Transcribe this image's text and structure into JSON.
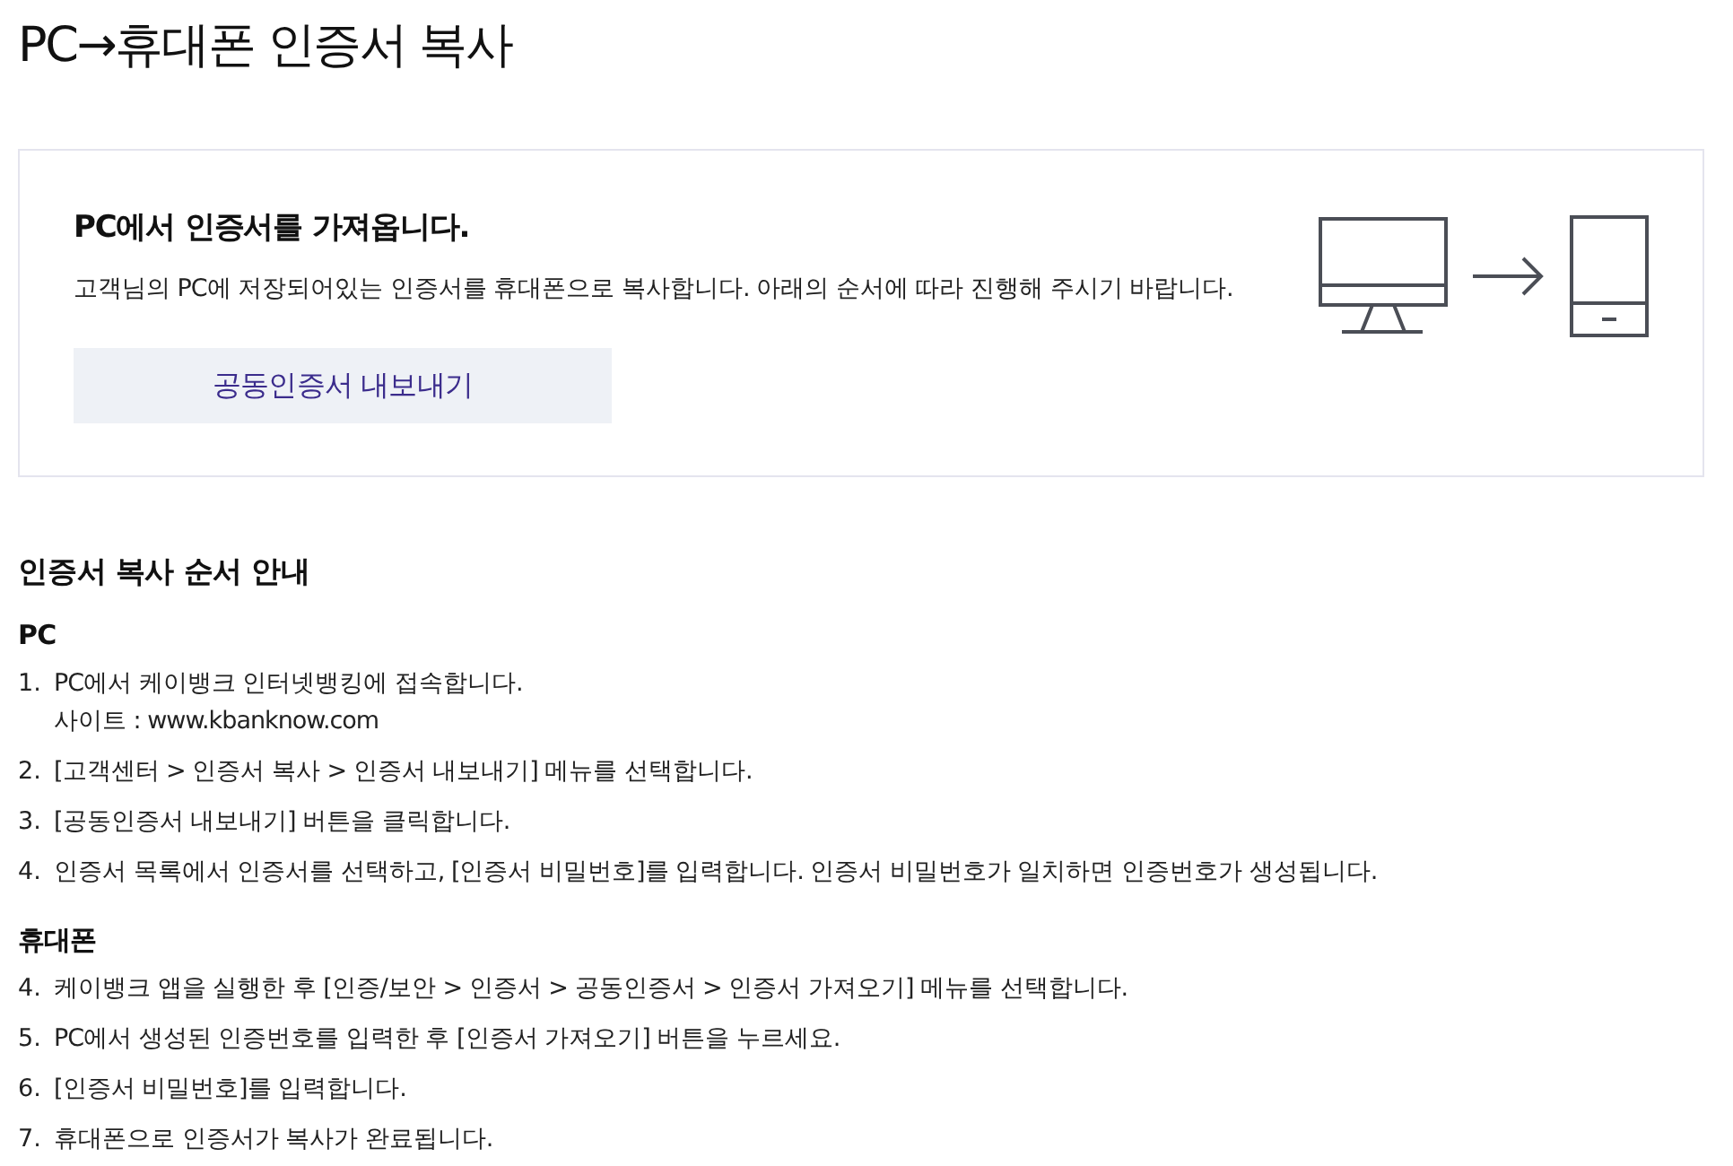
{
  "page": {
    "title": "PC→휴대폰 인증서 복사"
  },
  "intro_card": {
    "heading": "PC에서 인증서를 가져옵니다.",
    "description": "고객님의 PC에 저장되어있는 인증서를 휴대폰으로 복사합니다. 아래의 순서에 따라 진행해 주시기 바랍니다.",
    "button": "공동인증서 내보내기"
  },
  "guide": {
    "title": "인증서 복사 순서 안내",
    "sections": [
      {
        "heading": "PC",
        "steps": [
          {
            "number": "1.",
            "text": "PC에서 케이뱅크 인터넷뱅킹에 접속합니다.",
            "detail": "사이트 : www.kbanknow.com"
          },
          {
            "number": "2.",
            "text": "[고객센터 > 인증서 복사 > 인증서 내보내기] 메뉴를 선택합니다."
          },
          {
            "number": "3.",
            "text": "[공동인증서 내보내기] 버튼을 클릭합니다."
          },
          {
            "number": "4.",
            "text": "인증서 목록에서 인증서를 선택하고, [인증서 비밀번호]를 입력합니다. 인증서 비밀번호가 일치하면 인증번호가 생성됩니다."
          }
        ]
      },
      {
        "heading": "휴대폰",
        "steps": [
          {
            "number": "4.",
            "text": "케이뱅크 앱을 실행한 후 [인증/보안 > 인증서 > 공동인증서 > 인증서 가져오기] 메뉴를 선택합니다."
          },
          {
            "number": "5.",
            "text": "PC에서 생성된 인증번호를 입력한 후 [인증서 가져오기] 버튼을 누르세요."
          },
          {
            "number": "6.",
            "text": "[인증서 비밀번호]를 입력합니다."
          },
          {
            "number": "7.",
            "text": "휴대폰으로 인증서가 복사가 완료됩니다."
          }
        ]
      }
    ]
  }
}
